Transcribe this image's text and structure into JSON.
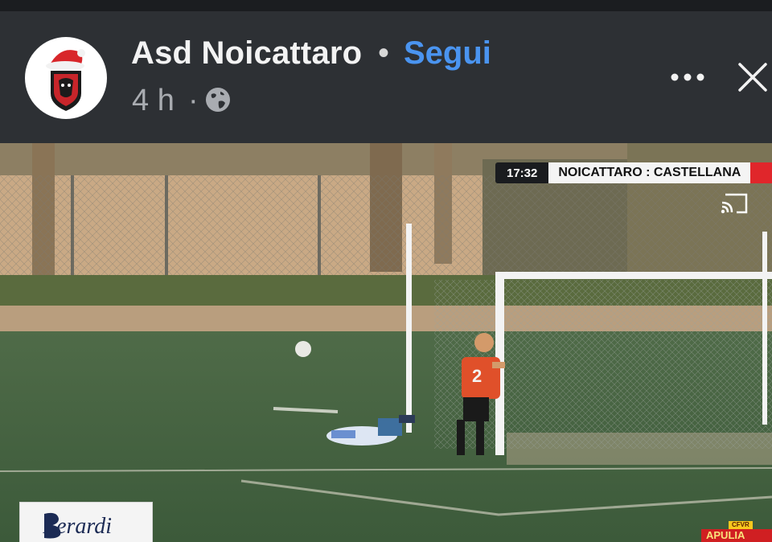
{
  "post": {
    "page_name": "Asd Noicattaro",
    "separator": "•",
    "follow_label": "Segui",
    "time_ago": "4 h",
    "time_separator": "·",
    "visibility_icon": "globe-icon",
    "more_icon": "more-horizontal-icon",
    "close_icon": "close-icon",
    "avatar": "club-crest-santa-hat"
  },
  "video": {
    "scorebug": {
      "clock": "17:32",
      "teams": "NOICATTARO : CASTELLANA"
    },
    "cast_icon": "cast-icon",
    "player_number": "2",
    "sponsor": "Berardi",
    "corner_badge_top": "CFVR",
    "corner_badge_main": "APULIA"
  },
  "colors": {
    "header_bg": "#2d3034",
    "follow_blue": "#4a94f0",
    "score_red": "#e0262b"
  }
}
